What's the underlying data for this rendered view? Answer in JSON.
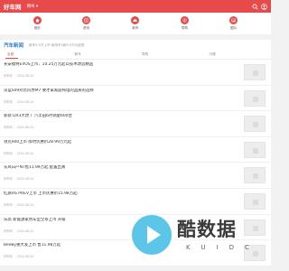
{
  "header": {
    "logo": "好车网",
    "city": "郑州 ▾",
    "icons": [
      "search-icon",
      "user-icon"
    ],
    "accent_color": "#e64a4a"
  },
  "nav": [
    {
      "label": "首页",
      "icon": "home-icon"
    },
    {
      "label": "资讯",
      "icon": "news-icon"
    },
    {
      "label": "新车",
      "icon": "car-icon"
    },
    {
      "label": "导购",
      "icon": "guide-icon"
    },
    {
      "label": "图片",
      "icon": "image-icon"
    }
  ],
  "section": {
    "title": "汽车新闻",
    "ticker": "新车5.9万上市 家用车5款5.9万元起售"
  },
  "tabs": [
    {
      "label": "全部",
      "active": true
    },
    {
      "label": "新车",
      "active": false
    },
    {
      "label": "导购",
      "active": false
    },
    {
      "label": "行情",
      "active": false
    }
  ],
  "items": [
    {
      "title": "长安福特EVOS上市，10.25万元起以技术改造精品",
      "source": "好车网",
      "date": "2024-08-24"
    },
    {
      "title": "深蓝S09对比问界M7 要才拿家庭纯电的品质的选择",
      "source": "好车网",
      "date": "2024-08-24"
    },
    {
      "title": "新款 DX3大改 广汽丰田6月销量600台",
      "source": "好车网",
      "date": "2024-08-24"
    },
    {
      "title": "领克900上市 限时优惠价28.99万元起",
      "source": "好车网",
      "date": "2024-08-24"
    },
    {
      "title": "东风日产N7售11.99万起 配置出真",
      "source": "好车网",
      "date": "2024-08-24"
    },
    {
      "title": "红旗HS PHEV上市 上市优惠价15.98万起",
      "source": "好车网",
      "date": "2024-08-24"
    },
    {
      "title": "乐高 新能源家用车型全系上市 升级",
      "source": "好车网",
      "date": "2024-08-24"
    },
    {
      "title": "BeeBy重大发上市 售11.98万起",
      "source": "好车网",
      "date": "2024-08-24"
    }
  ],
  "watermark": {
    "text": "酷数据",
    "sub": "KUIDC",
    "color": "#4fc2e8"
  }
}
